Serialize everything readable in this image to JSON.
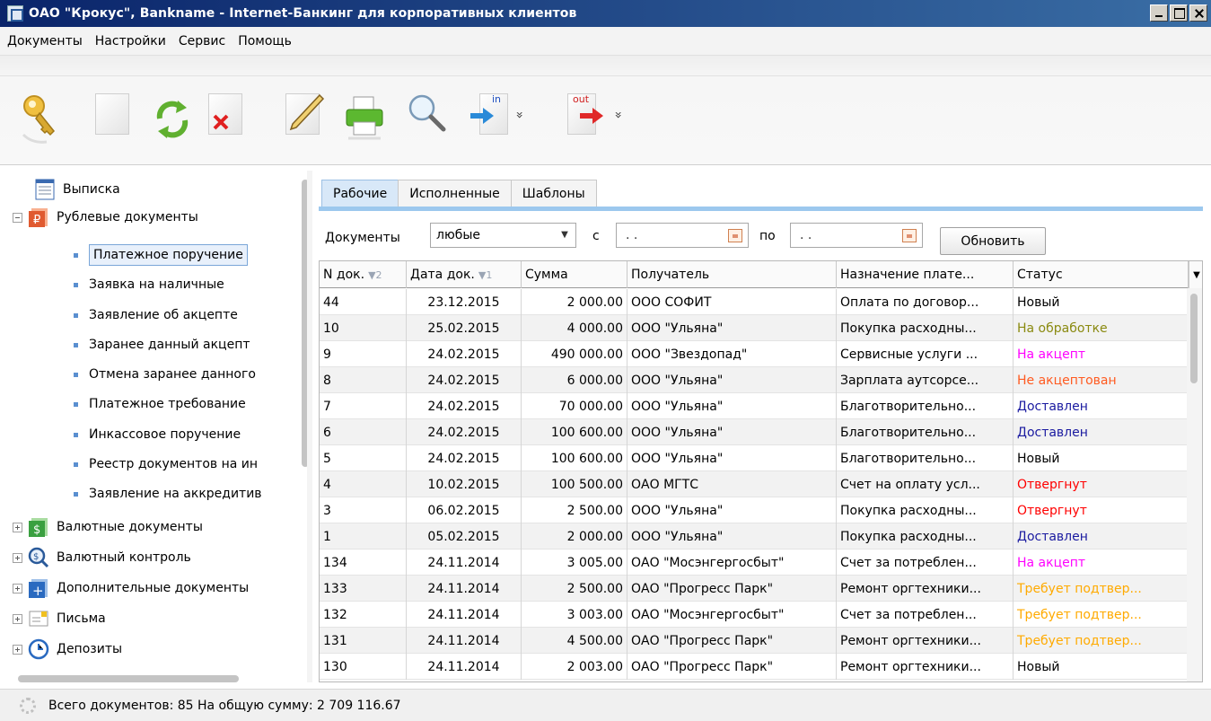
{
  "window": {
    "title": "ОАО \"Крокус\", Bankname - Internet-Банкинг для корпоративных клиентов"
  },
  "menu": [
    "Документы",
    "Настройки",
    "Сервис",
    "Помощь"
  ],
  "toolbar": {
    "icons": [
      "key-icon",
      "new-document-icon",
      "refresh-icon",
      "delete-icon",
      "edit-icon",
      "print-icon",
      "search-icon",
      "import-icon",
      "export-icon"
    ],
    "import_label": "in",
    "export_label": "out",
    "more_glyph": "»"
  },
  "tree": {
    "statement": "Выписка",
    "ruble_docs": "Рублевые документы",
    "ruble_children": [
      "Платежное поручение",
      "Заявка на наличные",
      "Заявление об акцепте",
      "Заранее данный акцепт",
      "Отмена заранее данного",
      "Платежное требование",
      "Инкассовое поручение",
      "Реестр документов на ин",
      "Заявление на аккредитив"
    ],
    "currency_docs": "Валютные документы",
    "currency_control": "Валютный контроль",
    "additional_docs": "Дополнительные документы",
    "letters": "Письма",
    "deposits": "Депозиты"
  },
  "tabs": [
    "Рабочие",
    "Исполненные",
    "Шаблоны"
  ],
  "filter": {
    "documents_label": "Документы",
    "documents_value": "любые",
    "from_label": "с",
    "from_value": ". .",
    "to_label": "по",
    "to_value": ". .",
    "refresh_label": "Обновить"
  },
  "table": {
    "columns": [
      {
        "label": "N док.",
        "sort": "▼2"
      },
      {
        "label": "Дата док.",
        "sort": "▼1"
      },
      {
        "label": "Сумма",
        "sort": ""
      },
      {
        "label": "Получатель",
        "sort": ""
      },
      {
        "label": "Назначение плате...",
        "sort": ""
      },
      {
        "label": "Статус",
        "sort": ""
      }
    ],
    "rows": [
      [
        "44",
        "23.12.2015",
        "2 000.00",
        "ООО СОФИТ",
        "Оплата по договор...",
        "Новый"
      ],
      [
        "10",
        "25.02.2015",
        "4 000.00",
        "ООО \"Ульяна\"",
        "Покупка расходны...",
        "На обработке"
      ],
      [
        "9",
        "24.02.2015",
        "490 000.00",
        "ООО \"Звездопад\"",
        "Сервисные услуги ...",
        "На акцепт"
      ],
      [
        "8",
        "24.02.2015",
        "6 000.00",
        "ООО \"Ульяна\"",
        "Зарплата аутсорсе...",
        "Не акцептован"
      ],
      [
        "7",
        "24.02.2015",
        "70 000.00",
        "ООО \"Ульяна\"",
        "Благотворительно...",
        "Доставлен"
      ],
      [
        "6",
        "24.02.2015",
        "100 600.00",
        "ООО \"Ульяна\"",
        "Благотворительно...",
        "Доставлен"
      ],
      [
        "5",
        "24.02.2015",
        "100 600.00",
        "ООО \"Ульяна\"",
        "Благотворительно...",
        "Новый"
      ],
      [
        "4",
        "10.02.2015",
        "100 500.00",
        "ОАО МГТС",
        "Счет на оплату усл...",
        "Отвергнут"
      ],
      [
        "3",
        "06.02.2015",
        "2 500.00",
        "ООО \"Ульяна\"",
        "Покупка расходны...",
        "Отвергнут"
      ],
      [
        "1",
        "05.02.2015",
        "2 000.00",
        "ООО \"Ульяна\"",
        "Покупка расходны...",
        "Доставлен"
      ],
      [
        "134",
        "24.11.2014",
        "3 005.00",
        "ОАО \"Мосэнгергосбыт\"",
        "Счет за потреблен...",
        "На акцепт"
      ],
      [
        "133",
        "24.11.2014",
        "2 500.00",
        "ОАО \"Прогресс Парк\"",
        "Ремонт оргтехники...",
        "Требует подтвер..."
      ],
      [
        "132",
        "24.11.2014",
        "3 003.00",
        "ОАО \"Мосэнгергосбыт\"",
        "Счет за потреблен...",
        "Требует подтвер..."
      ],
      [
        "131",
        "24.11.2014",
        "4 500.00",
        "ОАО \"Прогресс Парк\"",
        "Ремонт оргтехники...",
        "Требует подтвер..."
      ],
      [
        "130",
        "24.11.2014",
        "2 003.00",
        "ОАО \"Прогресс Парк\"",
        "Ремонт оргтехники...",
        "Новый"
      ]
    ]
  },
  "status_colors": {
    "Новый": "#000000",
    "На обработке": "#8a8a10",
    "На акцепт": "#ff00ff",
    "Не акцептован": "#ff5a20",
    "Доставлен": "#1a1aa0",
    "Отвергнут": "#ff0000",
    "Требует подтвер...": "#ffaa00"
  },
  "statusbar": {
    "text": "Всего документов: 85 На общую сумму: 2 709 116.67"
  }
}
